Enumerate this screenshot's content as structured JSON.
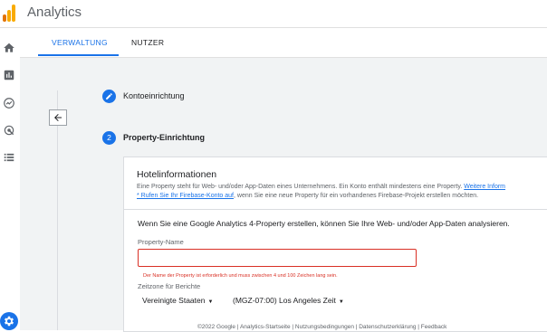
{
  "app": {
    "title": "Analytics",
    "brand_colors": [
      "#f9ab00",
      "#e37400"
    ]
  },
  "sidebar": {
    "items": [
      {
        "icon": "home-icon"
      },
      {
        "icon": "reports-icon"
      },
      {
        "icon": "explore-icon"
      },
      {
        "icon": "advertising-icon"
      },
      {
        "icon": "configure-icon"
      }
    ],
    "admin_icon": "gear-icon"
  },
  "tabs": [
    {
      "label": "VERWALTUNG",
      "active": true
    },
    {
      "label": "NUTZER",
      "active": false
    }
  ],
  "steps": [
    {
      "number": "",
      "label": "Kontoeinrichtung",
      "icon": "edit-icon"
    },
    {
      "number": "2",
      "label": "Property-Einrichtung"
    }
  ],
  "card": {
    "title": "Hotelinformationen",
    "desc_line1": "Eine Property steht für Web- und/oder App-Daten eines Unternehmens. Ein Konto enthält mindestens eine Property.",
    "desc_link1": "Weitere Inform",
    "desc_link2": "* Rufen Sie Ihr Firebase-Konto auf",
    "desc_line2": ", wenn Sie eine neue Property für ein vorhandenes Firebase-Projekt erstellen möchten.",
    "info": "Wenn Sie eine Google Analytics 4-Property erstellen, können Sie Ihre Web- und/oder App-Daten analysieren.",
    "property_name": {
      "label": "Property-Name",
      "value": "",
      "error": "Der Name der Property ist erforderlich und muss zwischen 4 und 100 Zeichen lang sein."
    },
    "timezone": {
      "label": "Zeitzone für Berichte",
      "country": "Vereinigte Staaten",
      "zone": "(MGZ-07:00) Los Angeles Zeit"
    }
  },
  "footer": "©2022 Google | Analytics-Startseite | Nutzungsbedingungen | Datenschutzerklärung | Feedback",
  "colors": {
    "accent": "#1a73e8",
    "error": "#d93025"
  }
}
